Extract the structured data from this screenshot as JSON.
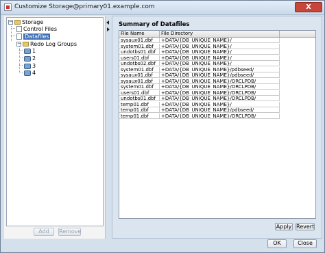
{
  "window": {
    "title": "Customize Storage@primary01.example.com",
    "close_glyph": "X"
  },
  "tree": {
    "root": "Storage",
    "items": [
      {
        "label": "Control Files"
      },
      {
        "label": "Datafiles",
        "selected": true
      },
      {
        "label": "Redo Log Groups"
      }
    ],
    "redo_groups": [
      "1",
      "2",
      "3",
      "4"
    ]
  },
  "left_buttons": {
    "add": "Add",
    "remove": "Remove"
  },
  "main": {
    "section_title": "Summary of Datafiles",
    "columns": [
      "File Name",
      "File Directory"
    ],
    "rows": [
      [
        "sysaux01.dbf",
        "+DATA/{DB_UNIQUE_NAME}/"
      ],
      [
        "system01.dbf",
        "+DATA/{DB_UNIQUE_NAME}/"
      ],
      [
        "undotbs01.dbf",
        "+DATA/{DB_UNIQUE_NAME}/"
      ],
      [
        "users01.dbf",
        "+DATA/{DB_UNIQUE_NAME}/"
      ],
      [
        "undotbs02.dbf",
        "+DATA/{DB_UNIQUE_NAME}/"
      ],
      [
        "system01.dbf",
        "+DATA/{DB_UNIQUE_NAME}/pdbseed/"
      ],
      [
        "sysaux01.dbf",
        "+DATA/{DB_UNIQUE_NAME}/pdbseed/"
      ],
      [
        "sysaux01.dbf",
        "+DATA/{DB_UNIQUE_NAME}/ORCLPDB/"
      ],
      [
        "system01.dbf",
        "+DATA/{DB_UNIQUE_NAME}/ORCLPDB/"
      ],
      [
        "users01.dbf",
        "+DATA/{DB_UNIQUE_NAME}/ORCLPDB/"
      ],
      [
        "undotbs01.dbf",
        "+DATA/{DB_UNIQUE_NAME}/ORCLPDB/"
      ],
      [
        "temp01.dbf",
        "+DATA/{DB_UNIQUE_NAME}/"
      ],
      [
        "temp01.dbf",
        "+DATA/{DB_UNIQUE_NAME}/pdbseed/"
      ],
      [
        "temp01.dbf",
        "+DATA/{DB_UNIQUE_NAME}/ORCLPDB/"
      ]
    ],
    "apply": "Apply",
    "revert": "Revert"
  },
  "footer": {
    "ok": "OK",
    "close": "Close"
  }
}
